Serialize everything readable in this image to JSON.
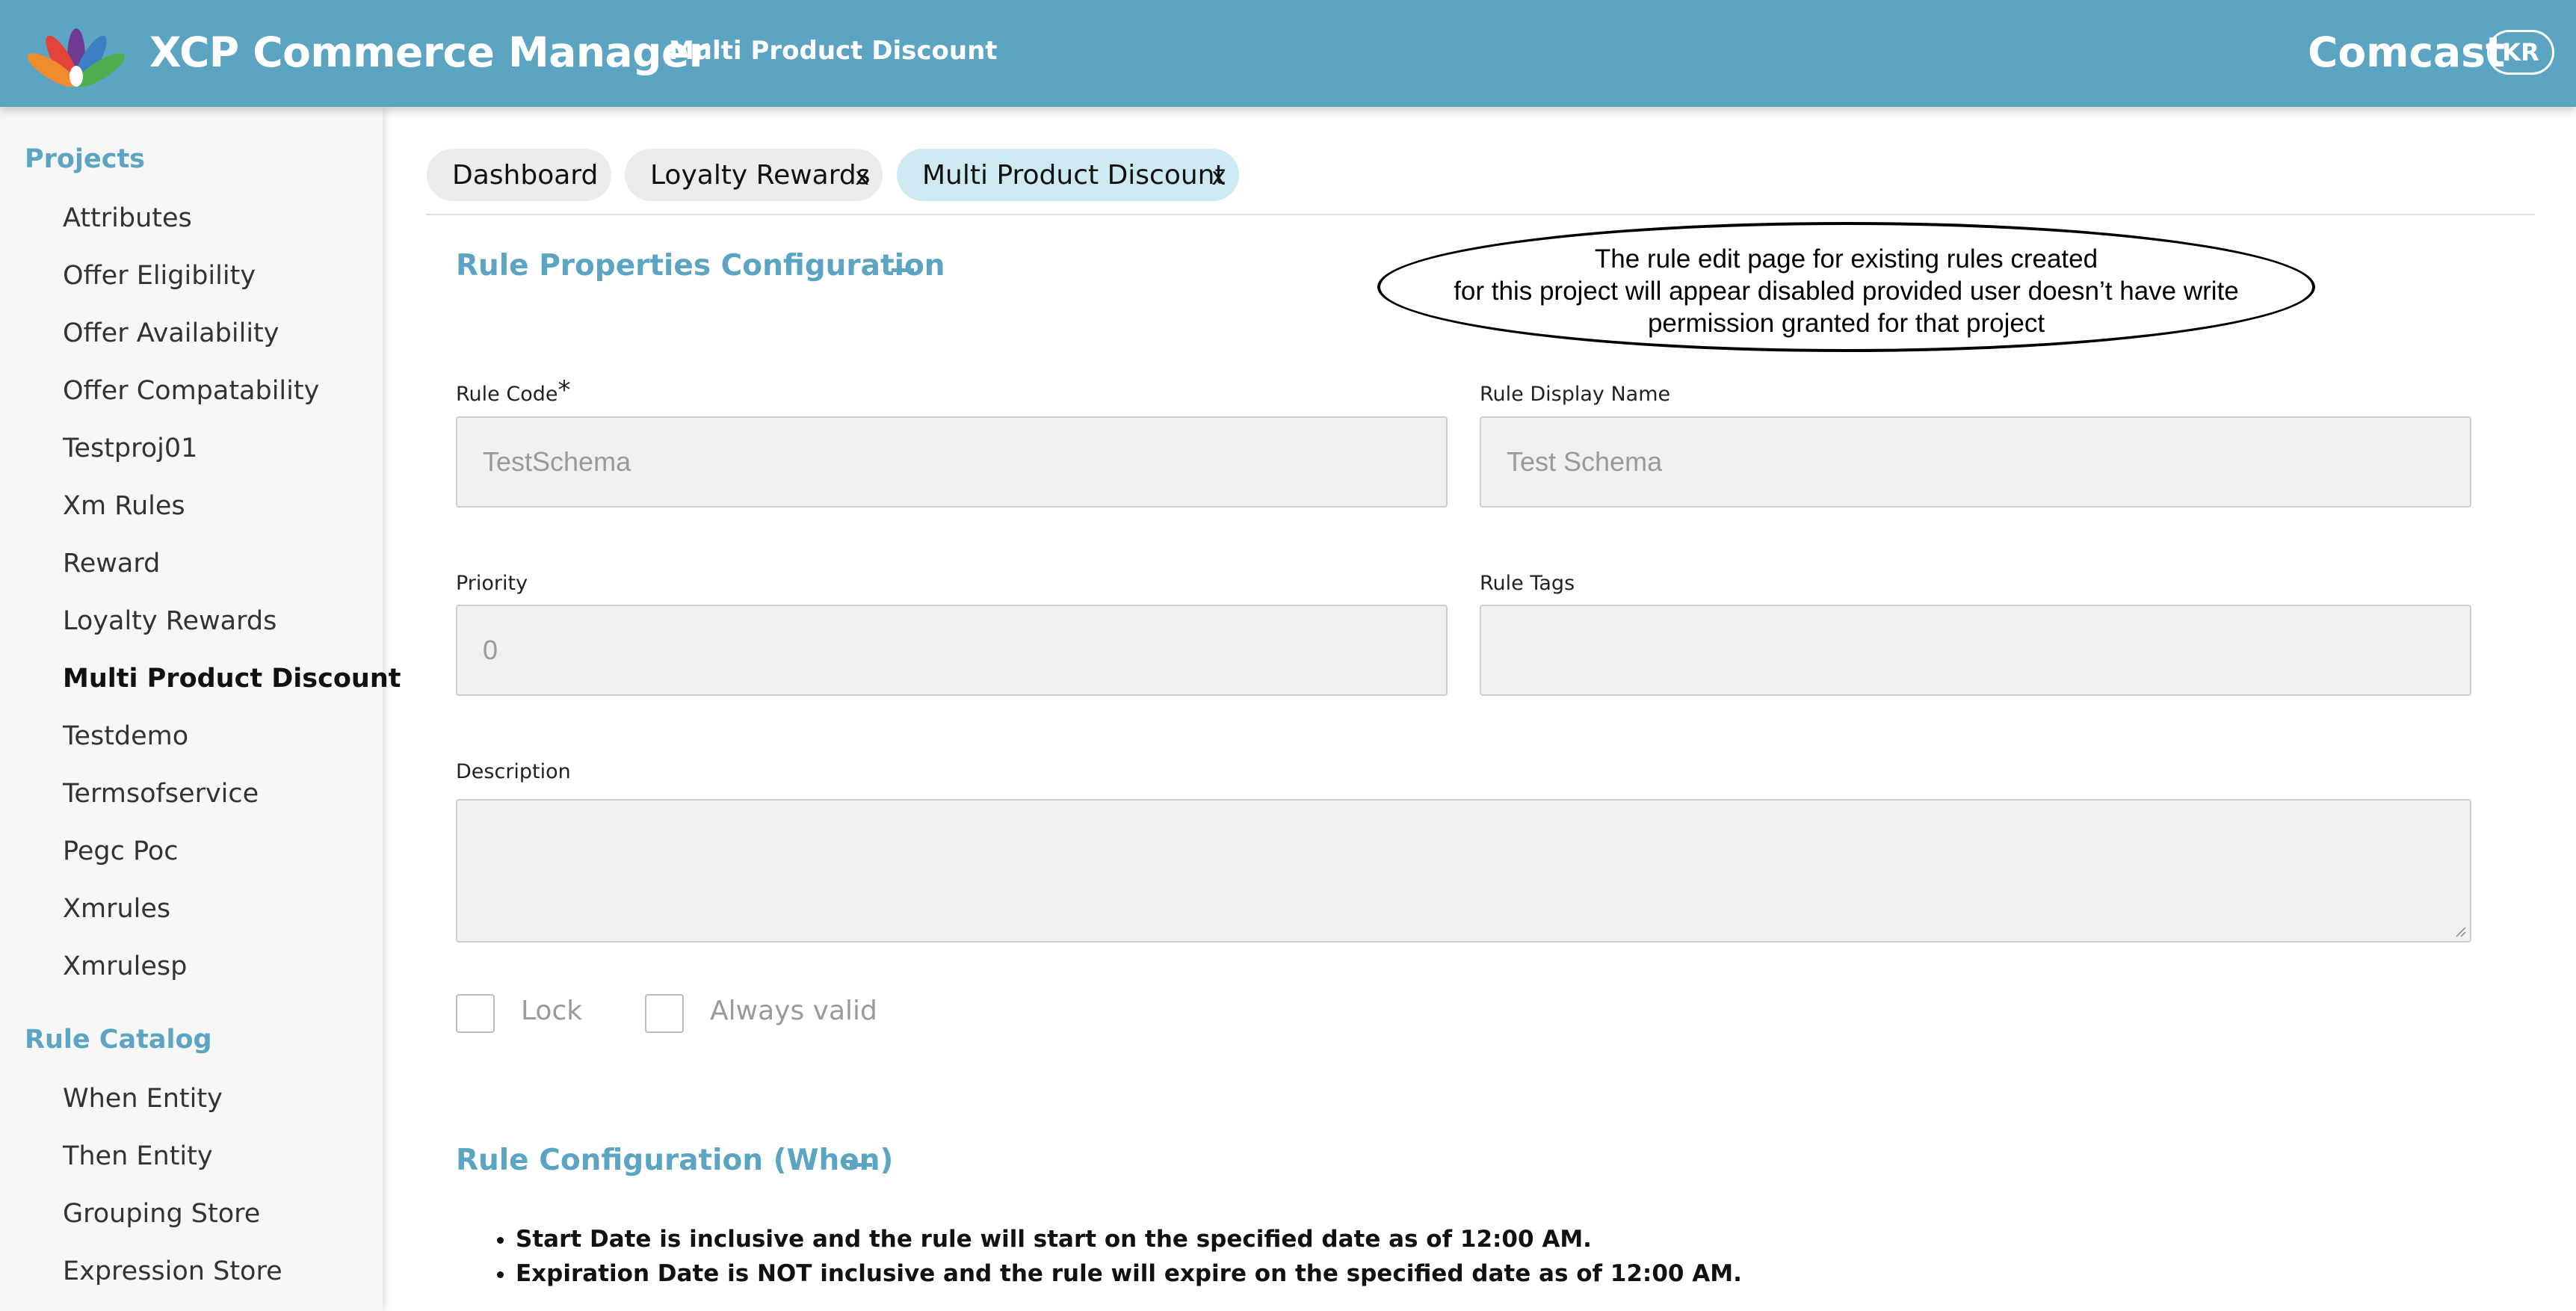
{
  "header": {
    "app_title": "XCP Commerce Manager",
    "page_title": "Multi Product Discount",
    "brand": "Comcast",
    "avatar_initials": "KR",
    "logo_icon": "peacock-logo-icon",
    "bar_color": "#5ba5c2"
  },
  "sidebar": {
    "projects_heading": "Projects",
    "project_items": [
      {
        "label": "Attributes"
      },
      {
        "label": "Offer Eligibility"
      },
      {
        "label": "Offer Availability"
      },
      {
        "label": "Offer Compatability"
      },
      {
        "label": "Testproj01"
      },
      {
        "label": "Xm Rules"
      },
      {
        "label": "Reward"
      },
      {
        "label": "Loyalty Rewards"
      },
      {
        "label": "Multi Product Discount",
        "active": true
      },
      {
        "label": "Testdemo"
      },
      {
        "label": "Termsofservice"
      },
      {
        "label": "Pegc Poc"
      },
      {
        "label": "Xmrules"
      },
      {
        "label": "Xmrulesp"
      }
    ],
    "catalog_heading": "Rule Catalog",
    "catalog_items": [
      {
        "label": "When Entity"
      },
      {
        "label": "Then Entity"
      },
      {
        "label": "Grouping Store"
      },
      {
        "label": "Expression Store"
      }
    ]
  },
  "tabs": [
    {
      "label": "Dashboard",
      "closable": false
    },
    {
      "label": "Loyalty Rewards",
      "closable": true
    },
    {
      "label": "Multi Product Discount",
      "closable": true,
      "active": true
    }
  ],
  "tab_close_glyph": "x",
  "rule_properties": {
    "title": "Rule Properties Configuration",
    "rule_code_label": "Rule Code",
    "required_mark": "*",
    "rule_code_value": "TestSchema",
    "rule_display_name_label": "Rule Display Name",
    "rule_display_name_value": "Test Schema",
    "priority_label": "Priority",
    "priority_value": "0",
    "rule_tags_label": "Rule Tags",
    "rule_tags_value": "",
    "description_label": "Description",
    "description_value": "",
    "lock_label": "Lock",
    "lock_checked": false,
    "always_valid_label": "Always valid",
    "always_valid_checked": false
  },
  "annotation": {
    "line1": "The rule edit page for existing rules created",
    "line2": "for this project will appear disabled provided user doesn’t have write",
    "line3": "permission granted for that project"
  },
  "rule_config_when": {
    "title": "Rule Configuration (When)",
    "notes": [
      "Start Date is inclusive and the rule will start on the specified date as of 12:00 AM.",
      "Expiration Date is NOT inclusive and the rule will expire on the specified date as of 12:00 AM."
    ]
  }
}
